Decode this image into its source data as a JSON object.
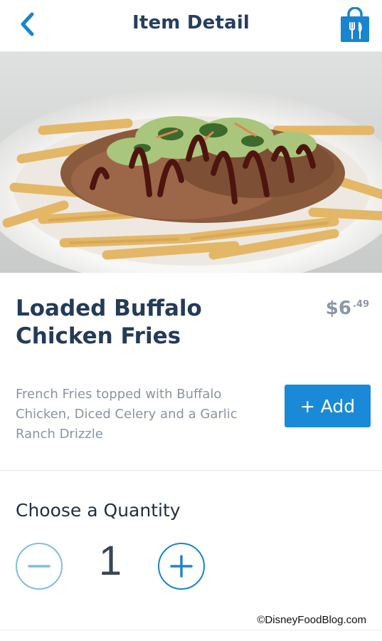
{
  "header": {
    "title": "Item Detail",
    "back_icon": "chevron-left-icon",
    "bag_icon": "shopping-bag-utensils-icon",
    "accent_color": "#1a8ad8"
  },
  "item": {
    "name": "Loaded Buffalo Chicken Fries",
    "price_dollars": "$6",
    "price_cents": ".49",
    "description": "French Fries topped with Buffalo Chicken, Diced Celery and a Garlic Ranch Drizzle",
    "add_label": "+ Add"
  },
  "quantity": {
    "label": "Choose a Quantity",
    "value": "1",
    "minus_icon": "minus-circle-icon",
    "plus_icon": "plus-circle-icon"
  },
  "watermark": "©DisneyFoodBlog.com"
}
